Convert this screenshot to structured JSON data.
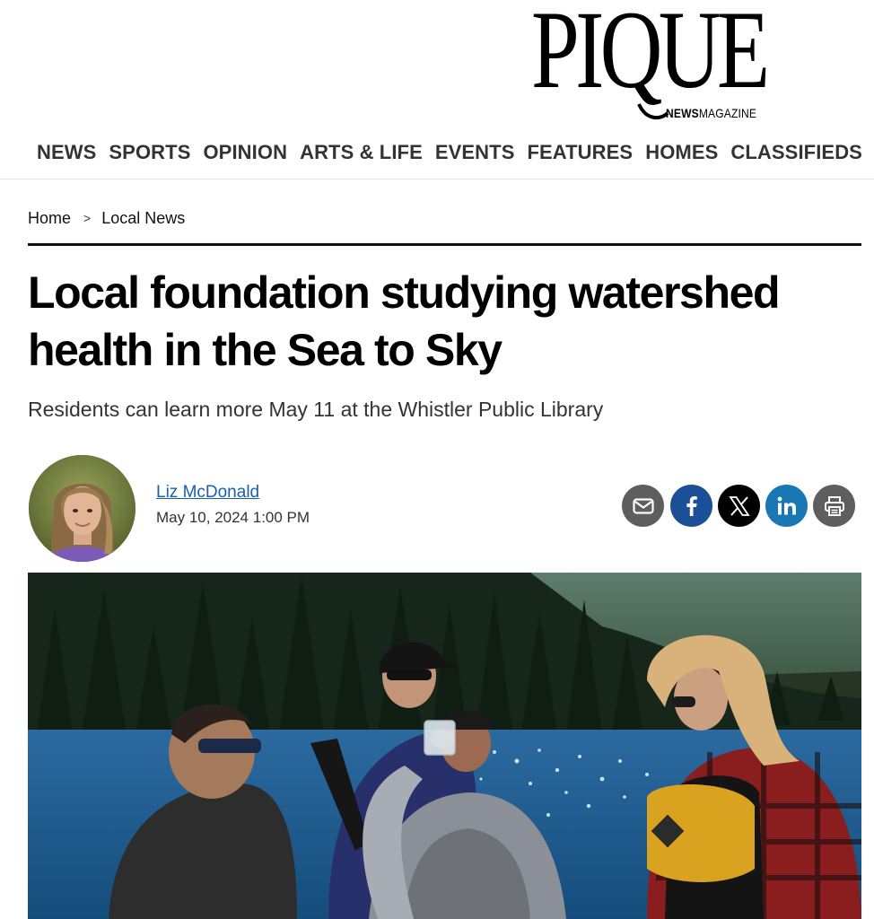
{
  "site": {
    "logo_word": "PIQUE",
    "logo_sub_bold": "NEWS",
    "logo_sub_rest": "MAGAZINE"
  },
  "nav": {
    "items": [
      {
        "label": "NEWS"
      },
      {
        "label": "SPORTS"
      },
      {
        "label": "OPINION"
      },
      {
        "label": "ARTS & LIFE"
      },
      {
        "label": "EVENTS"
      },
      {
        "label": "FEATURES"
      },
      {
        "label": "HOMES"
      },
      {
        "label": "CLASSIFIEDS"
      }
    ]
  },
  "breadcrumb": {
    "home": "Home",
    "separator": ">",
    "section": "Local News"
  },
  "article": {
    "headline": "Local foundation studying watershed health in the Sea to Sky",
    "subhead": "Residents can learn more May 11 at the Whistler Public Library",
    "author": "Liz McDonald",
    "date": "May 10, 2024 1:00 PM"
  },
  "share": {
    "icons": [
      "envelope-icon",
      "facebook-icon",
      "x-icon",
      "linkedin-icon",
      "printer-icon"
    ]
  },
  "colors": {
    "link": "#1a5fa8",
    "facebook": "#1b4f98",
    "linkedin": "#1a77b5",
    "icon_gray": "#5e5e5e",
    "rule": "#111111"
  }
}
